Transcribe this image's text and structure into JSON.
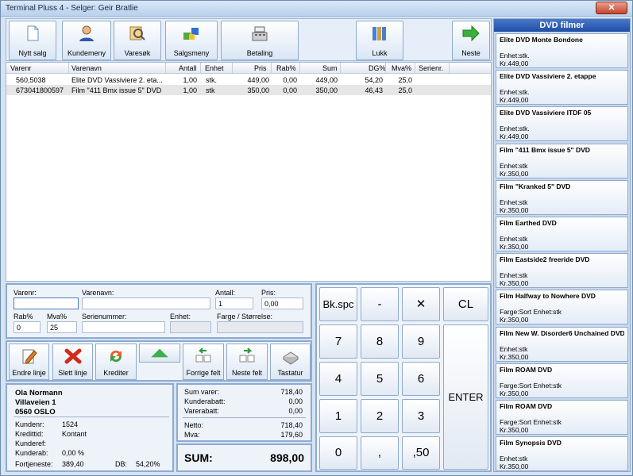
{
  "window": {
    "title": "Terminal Pluss 4 - Selger: Geir Bratlie",
    "close": "✕"
  },
  "toolbar": {
    "nytt_salg": "Nytt salg",
    "kundemeny": "Kundemeny",
    "varesok": "Varesøk",
    "salgsmeny": "Salgsmeny",
    "betaling": "Betaling",
    "lukk": "Lukk",
    "neste": "Neste"
  },
  "grid": {
    "headers": [
      "Varenr",
      "Varenavn",
      "Antall",
      "Enhet",
      "Pris",
      "Rab%",
      "Sum",
      "DG%",
      "Mva%",
      "Serienr."
    ],
    "rows": [
      {
        "varenr": "560,5038",
        "varenavn": "Elite DVD Vassiviere 2. eta...",
        "antall": "1,00",
        "enhet": "stk.",
        "pris": "449,00",
        "rab": "0,00",
        "sum": "449,00",
        "dg": "54,20",
        "mva": "25,0",
        "serienr": ""
      },
      {
        "varenr": "673041800597",
        "varenavn": "Film \"411 Bmx issue 5\" DVD",
        "antall": "1,00",
        "enhet": "stk",
        "pris": "350,00",
        "rab": "0,00",
        "sum": "350,00",
        "dg": "46,43",
        "mva": "25,0",
        "serienr": ""
      }
    ]
  },
  "form": {
    "varenr_label": "Varenr:",
    "varenr_value": "",
    "varenavn_label": "Varenavn:",
    "varenavn_value": "",
    "antall_label": "Antall:",
    "antall_value": "1",
    "pris_label": "Pris:",
    "pris_value": "0,00",
    "rab_label": "Rab%",
    "rab_value": "0",
    "mva_label": "Mva%",
    "mva_value": "25",
    "serie_label": "Serienummer:",
    "serie_value": "",
    "enhet_label": "Enhet:",
    "enhet_value": "",
    "farge_label": "Farge / Størrelse:",
    "farge_value": ""
  },
  "actions": {
    "endre": "Endre linje",
    "slett": "Slett linje",
    "krediter": "Krediter",
    "forrige": "Forrige felt",
    "neste_felt": "Neste felt",
    "tastatur": "Tastatur"
  },
  "customer": {
    "name": "Ola Normann",
    "street": "Villaveien 1",
    "city": "0560 OSLO",
    "kundenr_label": "Kundenr:",
    "kundenr": "1524",
    "kredittid_label": "Kredittid:",
    "kredittid": "Kontant",
    "kunderef_label": "Kunderef:",
    "kunderef": "",
    "kunderab_label": "Kunderab:",
    "kunderab": "0,00 %",
    "fortjeneste_label": "Fortjeneste:",
    "fortjeneste": "389,40",
    "db_label": "DB:",
    "db": "54,20%"
  },
  "summary": {
    "sum_varer_label": "Sum varer:",
    "sum_varer": "718,40",
    "kunderabatt_label": "Kunderabatt:",
    "kunderabatt": "0,00",
    "varerabatt_label": "Varerabatt:",
    "varerabatt": "0,00",
    "netto_label": "Netto:",
    "netto": "718,40",
    "mva_label": "Mva:",
    "mva": "179,60",
    "total_label": "SUM:",
    "total": "898,00"
  },
  "keypad": {
    "bksp": "Bk.spc",
    "minus": "-",
    "x": "✕",
    "cl": "CL",
    "k7": "7",
    "k8": "8",
    "k9": "9",
    "k4": "4",
    "k5": "5",
    "k6": "6",
    "k1": "1",
    "k2": "2",
    "k3": "3",
    "k0": "0",
    "comma": ",",
    "k50": ",50",
    "enter": "ENTER"
  },
  "dvd": {
    "title": "DVD filmer",
    "items": [
      {
        "name": "Elite DVD Monte Bondone",
        "unit": "Enhet:stk.",
        "price": "Kr.449,00"
      },
      {
        "name": "Elite DVD Vassiviere 2. etappe",
        "unit": "Enhet:stk.",
        "price": "Kr.449,00"
      },
      {
        "name": "Elite DVD Vassiviere ITDF 05",
        "unit": "Enhet:stk.",
        "price": "Kr.449,00"
      },
      {
        "name": "Film \"411 Bmx issue 5\" DVD",
        "unit": "Enhet:stk",
        "price": "Kr.350,00"
      },
      {
        "name": "Film \"Kranked 5\" DVD",
        "unit": "Enhet:stk",
        "price": "Kr.350,00"
      },
      {
        "name": "Film Earthed DVD",
        "unit": "Enhet:stk",
        "price": "Kr.350,00"
      },
      {
        "name": "Film Eastside2 freeride DVD",
        "unit": "Enhet:stk",
        "price": "Kr.350,00"
      },
      {
        "name": "Film Halfway to Nowhere DVD",
        "unit": "Farge:Sort  Enhet:stk",
        "price": "Kr.350,00"
      },
      {
        "name": "Film New W. Disorder6 Unchained DVD",
        "unit": "Enhet:stk",
        "price": "Kr.350,00"
      },
      {
        "name": "Film ROAM DVD",
        "unit": "Farge:Sort  Enhet:stk",
        "price": "Kr.350,00"
      },
      {
        "name": "Film ROAM DVD",
        "unit": "Farge:Sort  Enhet:stk",
        "price": "Kr.350,00"
      },
      {
        "name": "Film Synopsis DVD",
        "unit": "Enhet:stk",
        "price": "Kr.350,00"
      }
    ]
  }
}
